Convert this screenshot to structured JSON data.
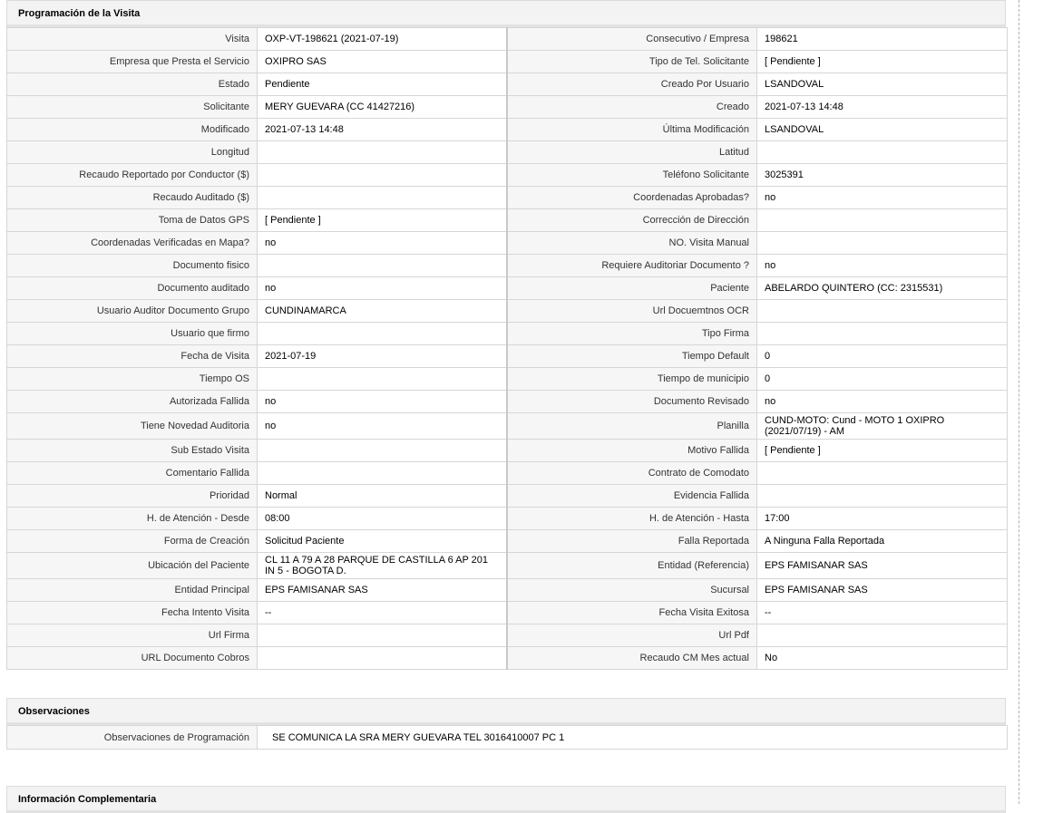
{
  "programacion": {
    "title": "Programación de la Visita",
    "rows": [
      {
        "l1": "Visita",
        "v1": "OXP-VT-198621 (2021-07-19)",
        "l2": "Consecutivo / Empresa",
        "v2": "198621"
      },
      {
        "l1": "Empresa que Presta el Servicio",
        "v1": "OXIPRO SAS",
        "l2": "Tipo de Tel. Solicitante",
        "v2": "[ Pendiente ]"
      },
      {
        "l1": "Estado",
        "v1": "Pendiente",
        "l2": "Creado Por Usuario",
        "v2": "LSANDOVAL"
      },
      {
        "l1": "Solicitante",
        "v1": "MERY GUEVARA (CC 41427216)",
        "l2": "Creado",
        "v2": "2021-07-13 14:48"
      },
      {
        "l1": "Modificado",
        "v1": "2021-07-13 14:48",
        "l2": "Última Modificación",
        "v2": " LSANDOVAL"
      },
      {
        "l1": "Longitud",
        "v1": "",
        "l2": "Latitud",
        "v2": ""
      },
      {
        "l1": "Recaudo Reportado por Conductor ($)",
        "v1": "",
        "l2": "Teléfono Solicitante",
        "v2": "3025391"
      },
      {
        "l1": "Recaudo Auditado ($)",
        "v1": "",
        "l2": "Coordenadas Aprobadas?",
        "v2": " no"
      },
      {
        "l1": "Toma de Datos GPS",
        "v1": "[ Pendiente ]",
        "l2": "Corrección de Dirección",
        "v2": ""
      },
      {
        "l1": "Coordenadas Verificadas en Mapa?",
        "v1": " no",
        "l2": "NO. Visita Manual",
        "v2": ""
      },
      {
        "l1": "Documento fisico",
        "v1": "",
        "l2": "Requiere Auditoriar Documento ?",
        "v2": " no"
      },
      {
        "l1": "Documento auditado",
        "v1": " no",
        "l2": "Paciente",
        "v2": "ABELARDO QUINTERO (CC: 2315531)"
      },
      {
        "l1": "Usuario Auditor Documento Grupo",
        "v1": "CUNDINAMARCA",
        "l2": "Url Docuemtnos OCR",
        "v2": ""
      },
      {
        "l1": "Usuario que firmo",
        "v1": "",
        "l2": "Tipo Firma",
        "v2": ""
      },
      {
        "l1": "Fecha de Visita",
        "v1": " 2021-07-19",
        "l2": "Tiempo Default",
        "v2": "0"
      },
      {
        "l1": "Tiempo OS",
        "v1": "",
        "l2": "Tiempo de municipio",
        "v2": "0"
      },
      {
        "l1": "Autorizada Fallida",
        "v1": " no",
        "l2": "Documento Revisado",
        "v2": " no"
      },
      {
        "l1": "Tiene Novedad Auditoria",
        "v1": " no",
        "l2": "Planilla",
        "v2": "CUND-MOTO: Cund - MOTO 1 OXIPRO (2021/07/19) - AM"
      },
      {
        "l1": "Sub Estado Visita",
        "v1": "",
        "l2": "Motivo Fallida",
        "v2": "[ Pendiente ]"
      },
      {
        "l1": "Comentario Fallida",
        "v1": "",
        "l2": "Contrato de Comodato",
        "v2": ""
      },
      {
        "l1": "Prioridad",
        "v1": "Normal",
        "l2": "Evidencia Fallida",
        "v2": ""
      },
      {
        "l1": "H. de Atención - Desde",
        "v1": "08:00",
        "l2": "H. de Atención - Hasta",
        "v2": "17:00"
      },
      {
        "l1": "Forma de Creación",
        "v1": "Solicitud Paciente",
        "l2": "Falla Reportada",
        "v2": "A Ninguna Falla Reportada"
      },
      {
        "l1": "Ubicación del Paciente",
        "v1": "CL 11 A 79 A 28 PARQUE DE CASTILLA 6 AP 201 IN 5 - BOGOTA D.",
        "l2": "Entidad (Referencia)",
        "v2": "EPS FAMISANAR SAS"
      },
      {
        "l1": "Entidad Principal",
        "v1": "EPS FAMISANAR SAS",
        "l2": "Sucursal",
        "v2": "EPS FAMISANAR SAS"
      },
      {
        "l1": "Fecha Intento Visita",
        "v1": " --",
        "l2": "Fecha Visita Exitosa",
        "v2": " --"
      },
      {
        "l1": "Url Firma",
        "v1": "",
        "l2": "Url Pdf",
        "v2": ""
      },
      {
        "l1": "URL Documento Cobros",
        "v1": "",
        "l2": "Recaudo CM Mes actual",
        "v2": "No"
      }
    ]
  },
  "observaciones": {
    "title": "Observaciones",
    "label": "Observaciones de Programación",
    "value": "SE COMUNICA LA SRA MERY GUEVARA TEL 3016410007 PC 1"
  },
  "complementaria": {
    "title": "Información Complementaria"
  }
}
